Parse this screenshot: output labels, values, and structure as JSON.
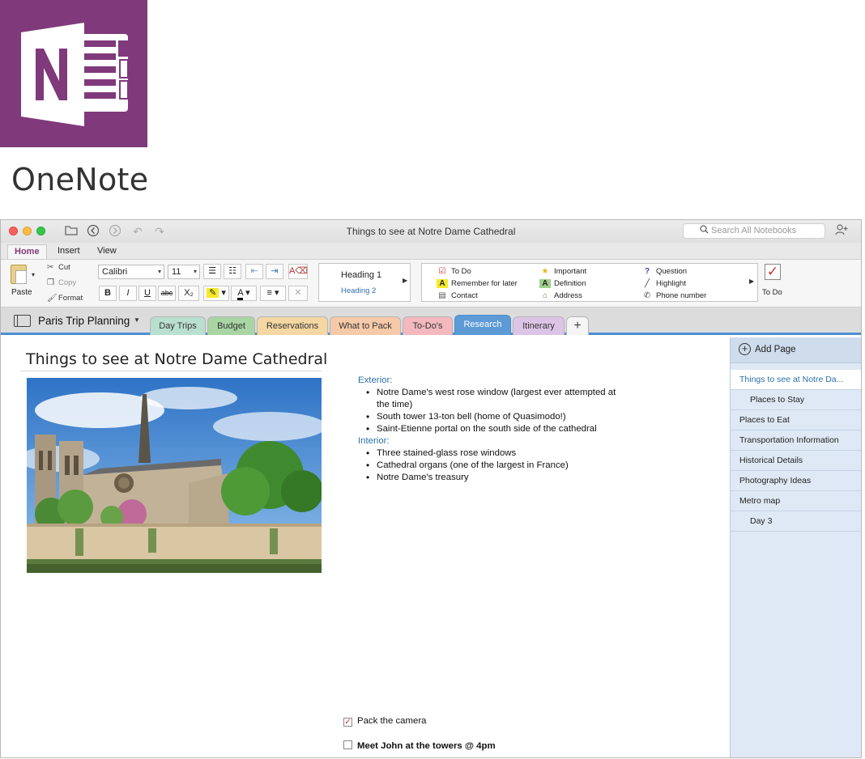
{
  "brand": {
    "name": "OneNote",
    "color": "#80397b"
  },
  "window": {
    "title": "Things to see at Notre Dame Cathedral",
    "search_placeholder": "Search All Notebooks"
  },
  "ribbon": {
    "tabs": [
      {
        "label": "Home",
        "active": true
      },
      {
        "label": "Insert",
        "active": false
      },
      {
        "label": "View",
        "active": false
      }
    ],
    "clipboard": {
      "paste": "Paste",
      "cut": "Cut",
      "copy": "Copy",
      "format": "Format"
    },
    "font": {
      "name": "Calibri",
      "size": "11"
    },
    "format_buttons": {
      "bold": "B",
      "italic": "I",
      "underline": "U",
      "strike": "abc",
      "subscript": "X₂"
    },
    "styles": {
      "heading1": "Heading 1",
      "heading2": "Heading 2"
    },
    "tags": [
      {
        "label": "To Do",
        "icon": "checkbox-icon"
      },
      {
        "label": "Remember for later",
        "icon": "highlight-a-icon"
      },
      {
        "label": "Contact",
        "icon": "contact-card-icon"
      },
      {
        "label": "Important",
        "icon": "star-icon"
      },
      {
        "label": "Definition",
        "icon": "definition-a-icon"
      },
      {
        "label": "Address",
        "icon": "house-icon"
      },
      {
        "label": "Question",
        "icon": "question-icon"
      },
      {
        "label": "Highlight",
        "icon": "pen-icon"
      },
      {
        "label": "Phone number",
        "icon": "phone-icon"
      }
    ],
    "todo_button": "To Do"
  },
  "notebook": {
    "name": "Paris Trip Planning",
    "sections": [
      {
        "label": "Day Trips",
        "color": "#b9dfd0"
      },
      {
        "label": "Budget",
        "color": "#a8d5a3"
      },
      {
        "label": "Reservations",
        "color": "#f4d7a2"
      },
      {
        "label": "What to Pack",
        "color": "#f6c9a8"
      },
      {
        "label": "To-Do's",
        "color": "#f3b9be"
      },
      {
        "label": "Research",
        "color": "#5d9ad6",
        "active": true
      },
      {
        "label": "Itinerary",
        "color": "#dcc4e6"
      }
    ],
    "add_section": "+"
  },
  "page": {
    "title": "Things to see at Notre Dame Cathedral",
    "exterior_heading": "Exterior:",
    "exterior": [
      "Notre Dame's west rose window (largest ever attempted at",
      "the time)",
      "South tower 13-ton bell (home of Quasimodo!)",
      "Saint-Etienne portal on the south side of the cathedral"
    ],
    "interior_heading": "Interior:",
    "interior": [
      "Three stained-glass rose windows",
      "Cathedral organs (one of the largest in France)",
      "Notre Dame's treasury"
    ],
    "todos": [
      {
        "label": "Pack the camera",
        "checked": true,
        "bold": false
      },
      {
        "label": "Meet John at the towers @ 4pm",
        "checked": false,
        "bold": true
      }
    ]
  },
  "pages_pane": {
    "add_page": "Add Page",
    "items": [
      {
        "label": "Things to see at Notre Da...",
        "selected": true,
        "sub": false
      },
      {
        "label": "Places to Stay",
        "selected": false,
        "sub": true
      },
      {
        "label": "Places to Eat",
        "selected": false,
        "sub": false
      },
      {
        "label": "Transportation Information",
        "selected": false,
        "sub": false
      },
      {
        "label": "Historical Details",
        "selected": false,
        "sub": false
      },
      {
        "label": "Photography Ideas",
        "selected": false,
        "sub": false
      },
      {
        "label": "Metro map",
        "selected": false,
        "sub": false
      },
      {
        "label": "Day 3",
        "selected": false,
        "sub": true
      }
    ]
  }
}
